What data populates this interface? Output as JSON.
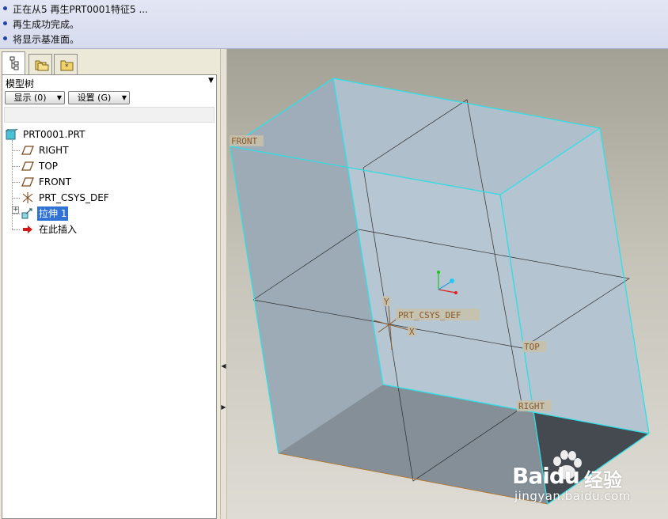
{
  "messages": [
    "正在从5 再生PRT0001特征5 ...",
    "再生成功完成。",
    "将显示基准面。"
  ],
  "tabs": [
    {
      "icon": "model-tree-icon",
      "active": true
    },
    {
      "icon": "folder-browser-icon",
      "active": false
    },
    {
      "icon": "favorites-icon",
      "active": false
    }
  ],
  "panel": {
    "title": "模型树",
    "show_button": "显示 (0)",
    "settings_button": "设置 (G)"
  },
  "tree": {
    "root": "PRT0001.PRT",
    "items": [
      {
        "label": "RIGHT",
        "icon": "datum-plane-icon"
      },
      {
        "label": "TOP",
        "icon": "datum-plane-icon"
      },
      {
        "label": "FRONT",
        "icon": "datum-plane-icon"
      },
      {
        "label": "PRT_CSYS_DEF",
        "icon": "coordinate-system-icon"
      },
      {
        "label": "拉伸 1",
        "icon": "extrude-icon",
        "selected": true,
        "expandable": true
      },
      {
        "label": "在此插入",
        "icon": "insert-here-arrow-icon"
      }
    ]
  },
  "viewport": {
    "labels": {
      "front": "FRONT",
      "top": "TOP",
      "right": "RIGHT",
      "csys": "PRT_CSYS_DEF",
      "axis_x": "X",
      "axis_y": "Y"
    },
    "colors": {
      "edge_highlight": "#2ee0e8",
      "datum_plane": "#b07a3a",
      "face_light": "#b3c3cf",
      "face_dark": "#788590",
      "face_bottom": "#454a4f"
    }
  },
  "watermark": {
    "brand": "Baidu",
    "product": "经验",
    "url": "jingyan.baidu.com"
  }
}
